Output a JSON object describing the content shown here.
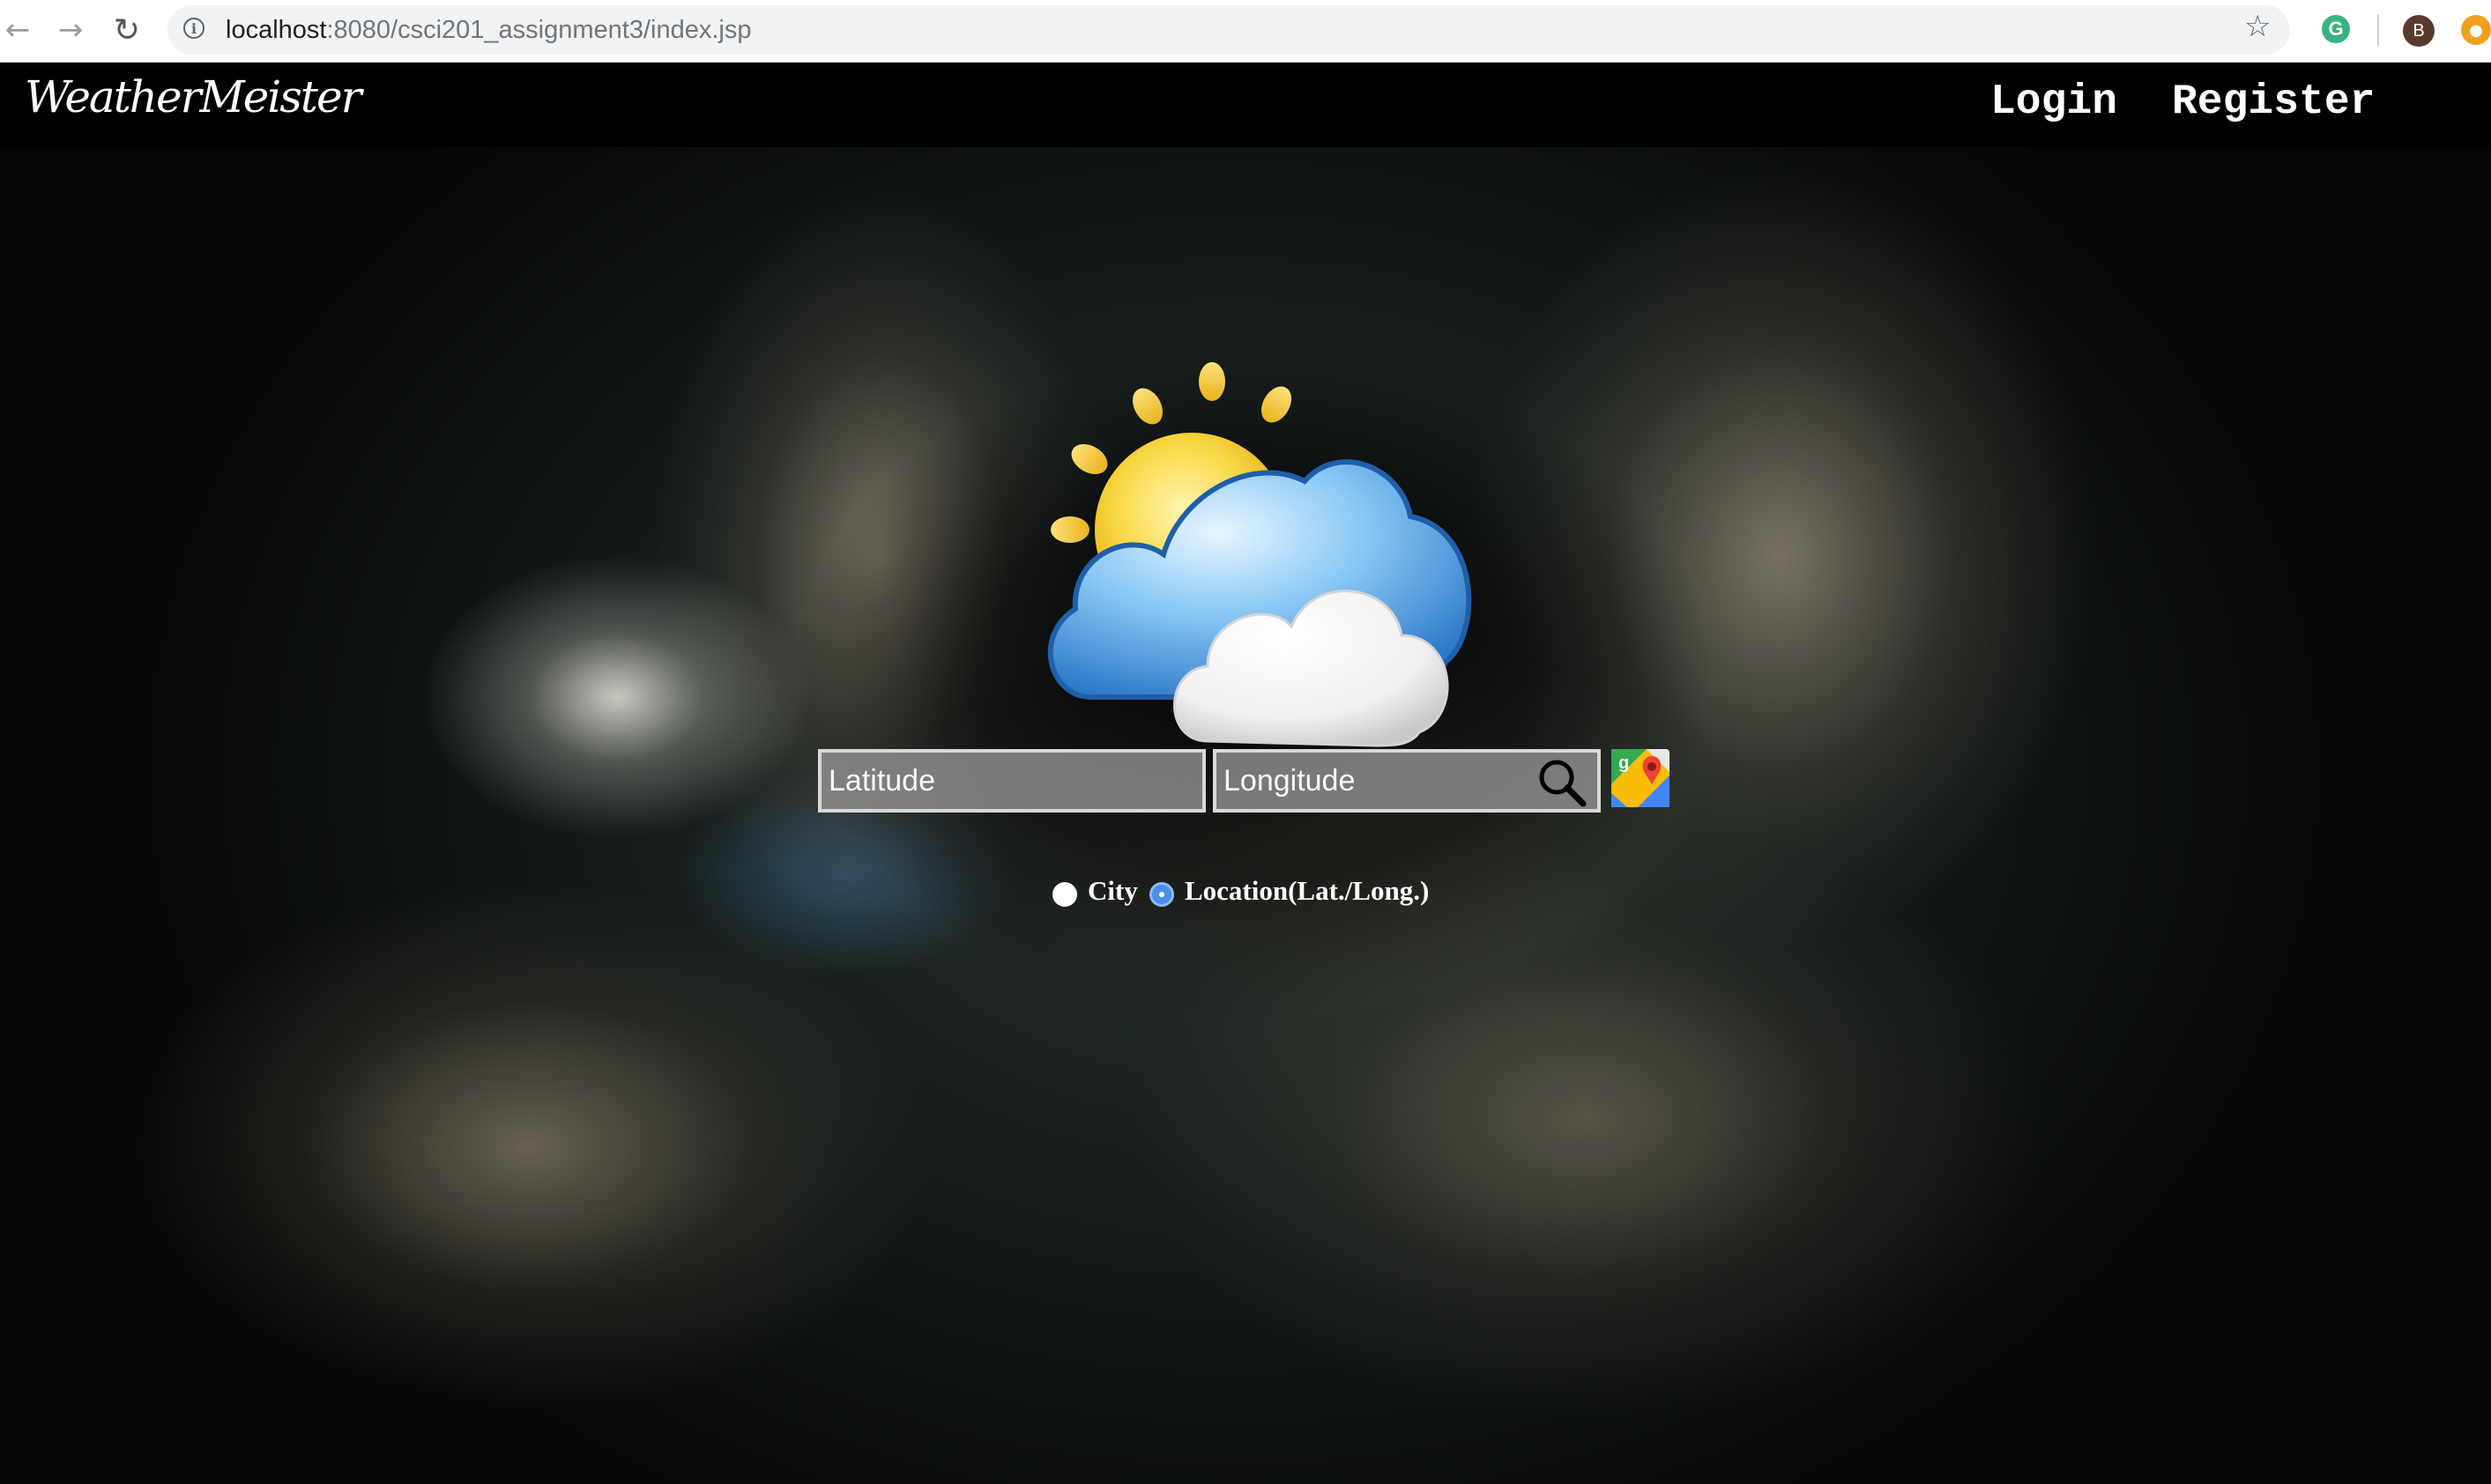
{
  "browser": {
    "url_host": "localhost",
    "url_path": ":8080/csci201_assignment3/index.jsp",
    "back_icon": "back-arrow-icon",
    "forward_icon": "forward-arrow-icon",
    "reload_icon": "reload-icon",
    "extension_g_label": "G",
    "avatar_label": "B"
  },
  "navbar": {
    "logo": "WeatherMeister",
    "login_label": "Login",
    "register_label": "Register"
  },
  "search": {
    "latitude_placeholder": "Latitude",
    "longitude_placeholder": "Longitude",
    "search_icon": "magnifier-icon",
    "maps_icon": "google-maps-icon"
  },
  "mode": {
    "city_label": "City",
    "location_label": "Location(Lat./Long.)",
    "selected": "location"
  },
  "colors": {
    "navbar_bg": "#000000",
    "radio_selected": "#4a8fe7",
    "field_border": "#d8d8d8"
  }
}
